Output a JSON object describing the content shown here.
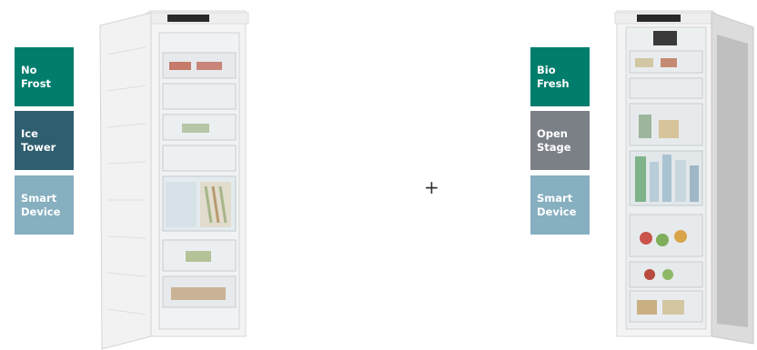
{
  "left_product": {
    "features": [
      {
        "label": "No\nFrost",
        "color": "#007d6c"
      },
      {
        "label": "Ice\nTower",
        "color": "#2f5e6f"
      },
      {
        "label": "Smart\nDevice",
        "color": "#86afc0"
      }
    ]
  },
  "separator": "+",
  "right_product": {
    "features": [
      {
        "label": "Bio\nFresh",
        "color": "#007d6c"
      },
      {
        "label": "Open\nStage",
        "color": "#7b8087"
      },
      {
        "label": "Smart\nDevice",
        "color": "#86afc0"
      }
    ]
  }
}
